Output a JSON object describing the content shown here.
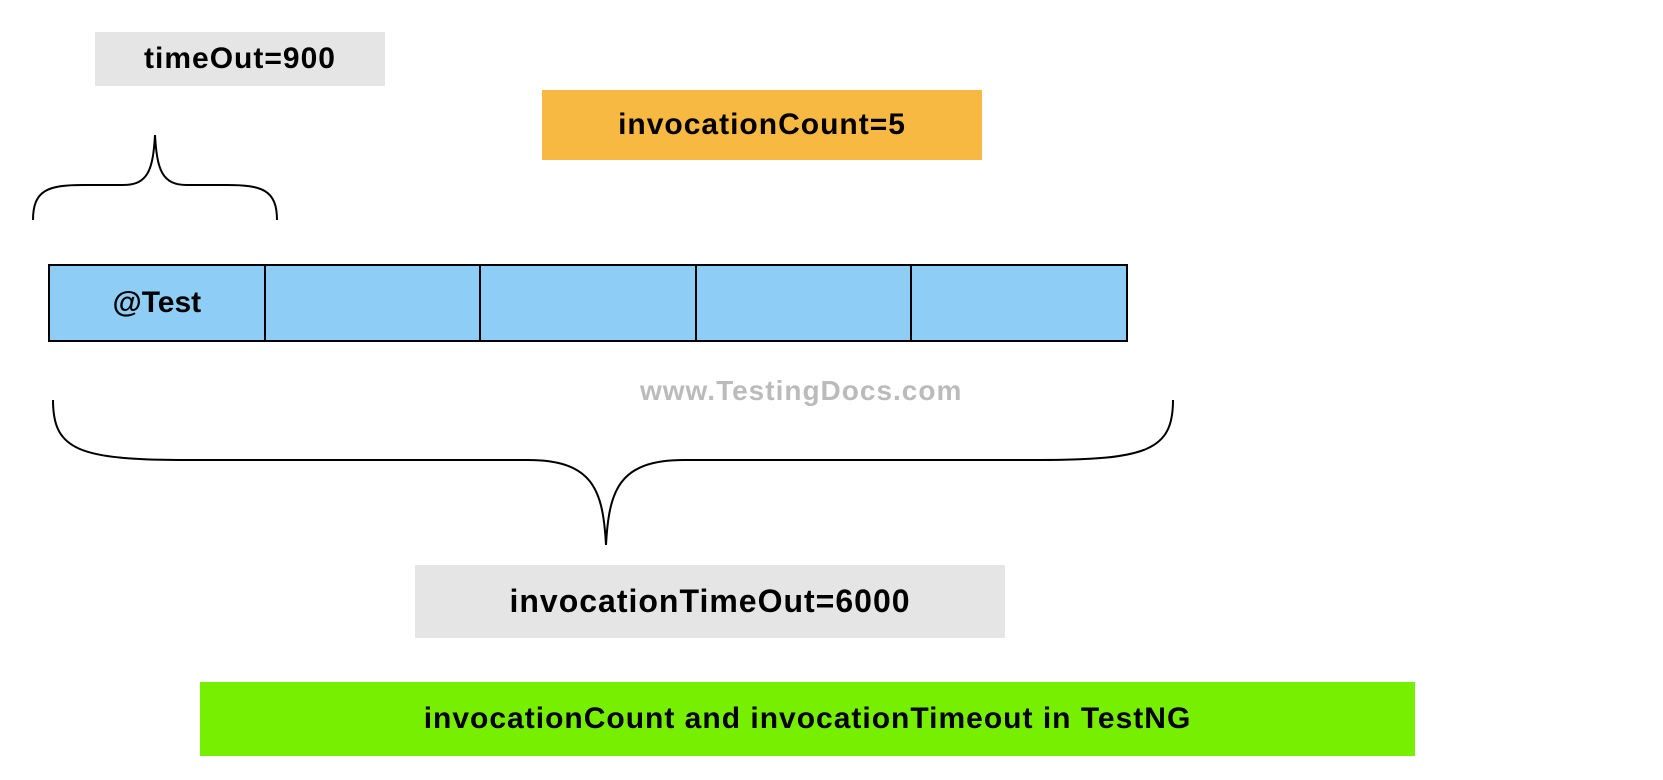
{
  "labels": {
    "timeout": "timeOut=900",
    "invocation_count": "invocationCount=5",
    "invocation_timeout": "invocationTimeOut=6000",
    "title": "invocationCount  and invocationTimeout in TestNG"
  },
  "test_bar": {
    "first_cell": "@Test",
    "count": 5
  },
  "watermark": "www.TestingDocs.com"
}
